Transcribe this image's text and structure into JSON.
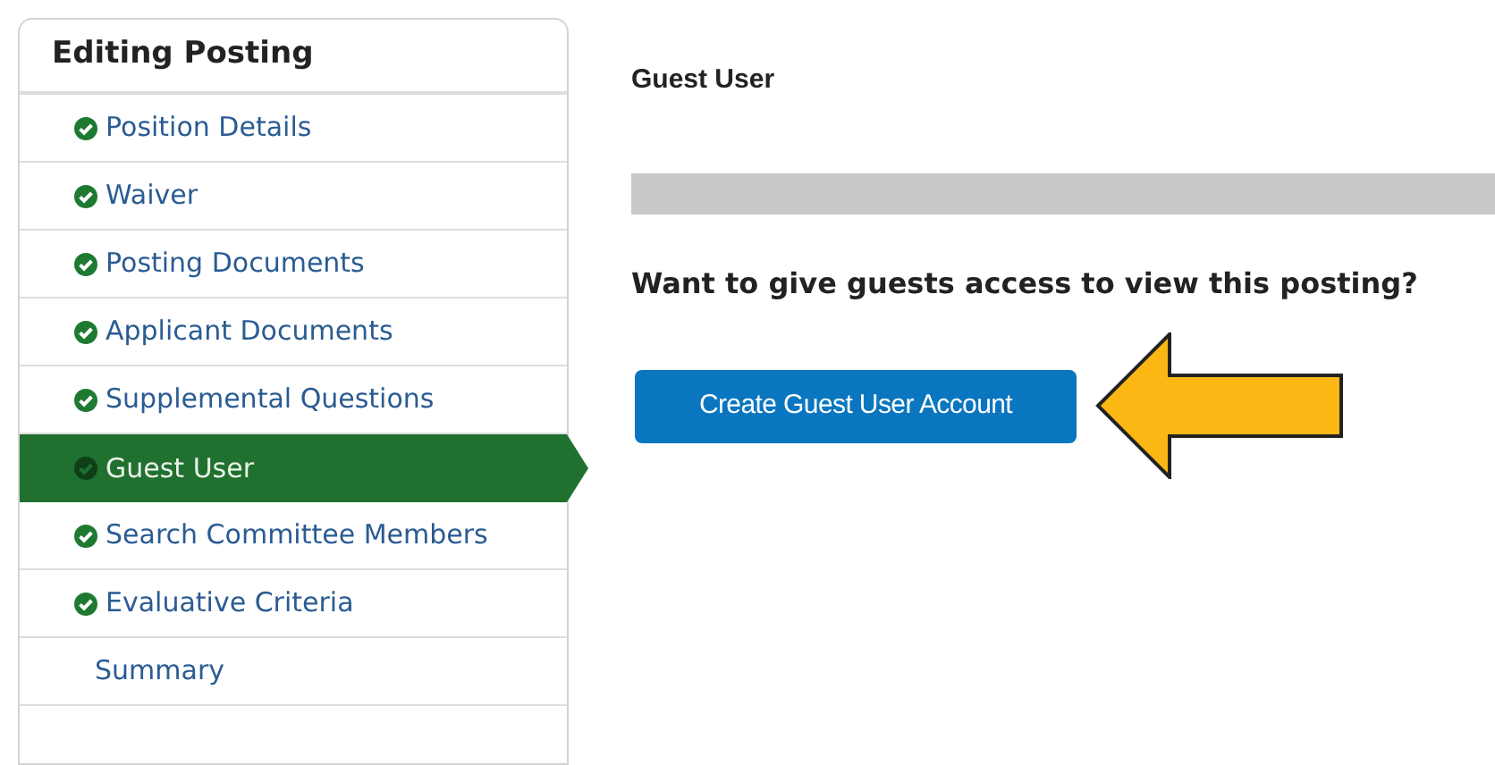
{
  "sidebar": {
    "title": "Editing Posting",
    "items": [
      {
        "label": "Position Details",
        "completed": true,
        "selected": false
      },
      {
        "label": "Waiver",
        "completed": true,
        "selected": false
      },
      {
        "label": "Posting Documents",
        "completed": true,
        "selected": false
      },
      {
        "label": "Applicant Documents",
        "completed": true,
        "selected": false
      },
      {
        "label": "Supplemental Questions",
        "completed": true,
        "selected": false
      },
      {
        "label": "Guest User",
        "completed": true,
        "selected": true
      },
      {
        "label": "Search Committee Members",
        "completed": true,
        "selected": false
      },
      {
        "label": "Evaluative Criteria",
        "completed": true,
        "selected": false
      },
      {
        "label": "Summary",
        "completed": false,
        "selected": false
      }
    ]
  },
  "main": {
    "title": "Guest User",
    "question": "Want to give guests access to view this posting?",
    "button": "Create Guest User Account"
  }
}
